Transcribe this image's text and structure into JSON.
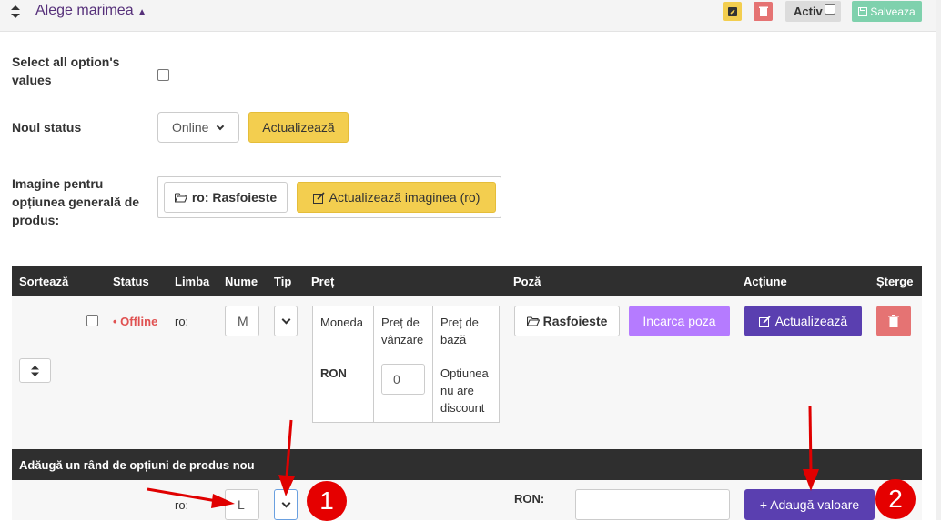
{
  "header": {
    "title": "Alege marimea",
    "activ_label": "Activ",
    "save_label": "Salveaza",
    "colors": {
      "edit": "#f3ce4f",
      "delete": "#e57373",
      "save": "#7fd1ad"
    }
  },
  "form": {
    "select_all_label": "Select all option's values",
    "new_status_label": "Noul status",
    "status_value": "Online",
    "update_label": "Actualizează",
    "image_label": "Imagine pentru opțiunea generală de produs:",
    "browse_label": "ro: Rasfoieste",
    "update_image_label": "Actualizează imaginea (ro)"
  },
  "table": {
    "headers": [
      "Sortează",
      "Status",
      "Limba",
      "Nume",
      "Tip",
      "Preț",
      "Poză",
      "Acțiune",
      "Șterge"
    ],
    "row": {
      "status": "• Offline",
      "lang": "ro:",
      "name": "M",
      "price_headers": [
        "Moneda",
        "Preț de vânzare",
        "Preț de bază"
      ],
      "currency": "RON",
      "sale_price": "0",
      "base_note": "Optiunea nu are discount",
      "browse_label": "Rasfoieste",
      "upload_label": "Incarca poza",
      "update_label": "Actualizează"
    }
  },
  "add_row": {
    "title": "Adăugă un rând de opțiuni de produs nou",
    "lang": "ro:",
    "name": "L",
    "currency_label": "RON:",
    "price_value": "",
    "add_label": "+ Adaugă valoare"
  },
  "annotations": {
    "marker1": "1",
    "marker2": "2"
  }
}
